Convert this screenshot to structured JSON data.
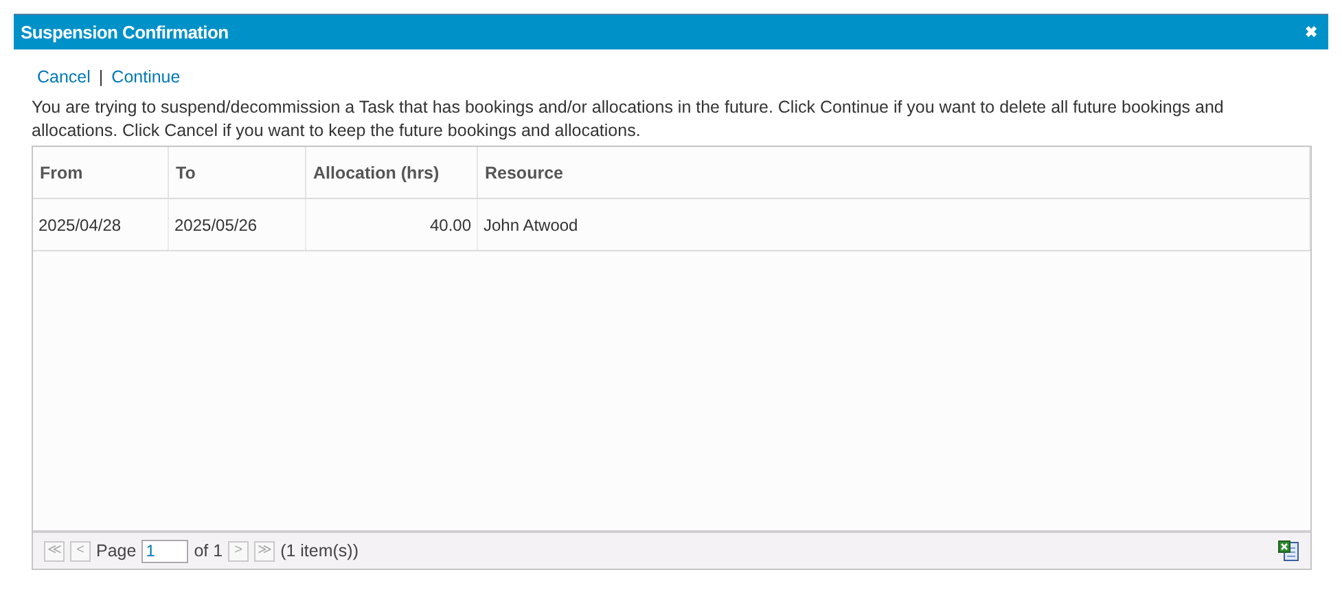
{
  "window": {
    "title": "Suspension Confirmation",
    "close": "✖"
  },
  "links": [
    "Cancel",
    "Continue"
  ],
  "link_separator": "|",
  "message": "You are trying to suspend/decommission a Task that has bookings and/or allocations in the future. Click Continue if you want to delete all future bookings and allocations. Click Cancel if you want to keep the future bookings and allocations.",
  "table": {
    "columns": [
      {
        "label": "From",
        "kind": "text"
      },
      {
        "label": "To",
        "kind": "text"
      },
      {
        "label": "Allocation (hrs)",
        "kind": "number"
      },
      {
        "label": "Resource",
        "kind": "text"
      }
    ],
    "rows": [
      [
        "2025/04/28",
        "2025/05/26",
        "40.00",
        "John Atwood"
      ]
    ]
  },
  "pager": {
    "first": "≪",
    "prev": "<",
    "page_label": "Page",
    "page_value": "1",
    "of": "of 1",
    "next": ">",
    "last": "≫",
    "items": "(1 item(s))"
  }
}
